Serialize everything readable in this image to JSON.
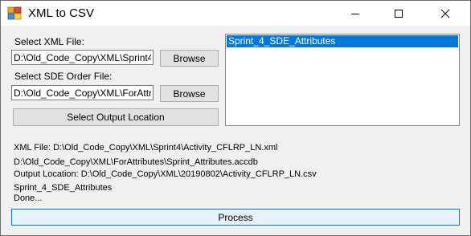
{
  "window": {
    "title": "XML to CSV",
    "icon": "xml-to-csv-app-icon"
  },
  "titlebar_buttons": {
    "minimize_icon": "minimize-icon",
    "maximize_icon": "maximize-icon",
    "close_icon": "close-icon"
  },
  "xml_file": {
    "label": "Select XML File:",
    "value": "D:\\Old_Code_Copy\\XML\\Sprint4\\Activity_CFLRP_LN.xml",
    "browse_label": "Browse"
  },
  "sde_order_file": {
    "label": "Select SDE Order File:",
    "value": "D:\\Old_Code_Copy\\XML\\ForAttributes\\Sprint_Attributes.accdb",
    "browse_label": "Browse"
  },
  "output": {
    "button_label": "Select Output Location"
  },
  "attribute_list": {
    "items": [
      {
        "label": "Sprint_4_SDE_Attributes",
        "selected": true
      }
    ]
  },
  "status_lines": [
    "XML File: D:\\Old_Code_Copy\\XML\\Sprint4\\Activity_CFLRP_LN.xml",
    "D:\\Old_Code_Copy\\XML\\ForAttributes\\Sprint_Attributes.accdb",
    "Output Location: D:\\Old_Code_Copy\\XML\\20190802\\Activity_CFLRP_LN.csv",
    "Sprint_4_SDE_Attributes",
    "Done..."
  ],
  "process": {
    "label": "Process"
  },
  "colors": {
    "selection": "#0078d7",
    "window_bg": "#f0f0f0",
    "button_bg": "#e1e1e1",
    "process_border": "#0078d7"
  }
}
